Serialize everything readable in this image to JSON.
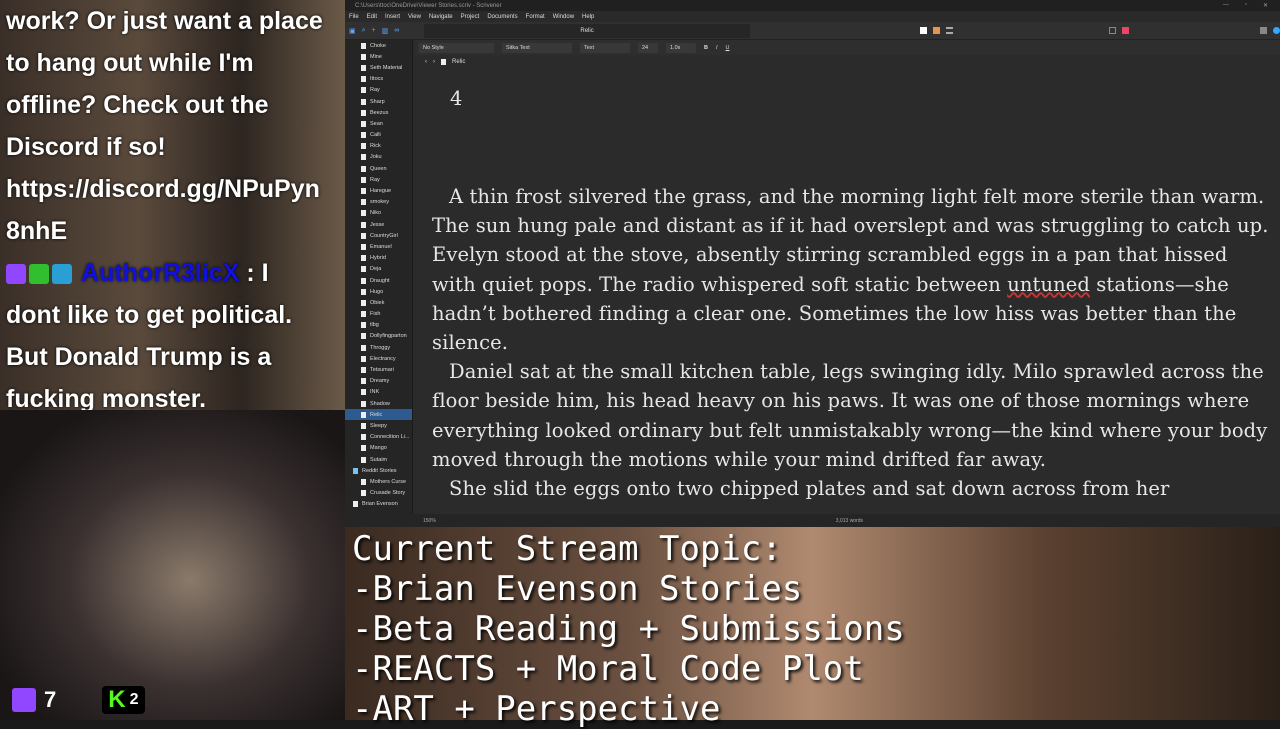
{
  "chat": {
    "lines": [
      "work? Or just want a place",
      "to hang out while I'm",
      "offline? Check out the",
      "Discord if so!",
      "https://discord.gg/NPuPyn",
      "8nhE"
    ],
    "username": "AuthorR3licX",
    "message_sep": " : I",
    "message_lines": [
      "dont like to get political.",
      "But Donald Trump is a",
      "fucking monster."
    ]
  },
  "stats": {
    "twitch_viewers": "7",
    "kick_viewers": "2",
    "kick_logo": "K"
  },
  "app": {
    "title": "C:\\Users\\ttoc\\OneDrive\\Viewer Stories.scriv - Scrivener",
    "menu": [
      "File",
      "Edit",
      "Insert",
      "View",
      "Navigate",
      "Project",
      "Documents",
      "Format",
      "Window",
      "Help"
    ],
    "doc_title": "Relic",
    "format": {
      "style": "No Style",
      "font": "Sitka Text",
      "typeface": "Text",
      "size": "24",
      "spacing": "1.0x",
      "bold": "B",
      "italic": "I",
      "underline": "U"
    },
    "header_doc": "Relic",
    "binder": [
      {
        "label": "Choke"
      },
      {
        "label": "Mine"
      },
      {
        "label": "Seth Material"
      },
      {
        "label": "Ittocs"
      },
      {
        "label": "Ray"
      },
      {
        "label": "Sharp"
      },
      {
        "label": "Beezus"
      },
      {
        "label": "Sean"
      },
      {
        "label": "Calli"
      },
      {
        "label": "Rick"
      },
      {
        "label": "Joku"
      },
      {
        "label": "Queen"
      },
      {
        "label": "Ray"
      },
      {
        "label": "Haregue"
      },
      {
        "label": "smokey"
      },
      {
        "label": "Niko"
      },
      {
        "label": "Jesse"
      },
      {
        "label": "CountryGirl"
      },
      {
        "label": "Emanuel"
      },
      {
        "label": "Hybrid"
      },
      {
        "label": "Deja"
      },
      {
        "label": "Draught"
      },
      {
        "label": "Hugo"
      },
      {
        "label": "Obiek"
      },
      {
        "label": "Fish"
      },
      {
        "label": "tlbg"
      },
      {
        "label": "Dollyfingparton"
      },
      {
        "label": "Throggy"
      },
      {
        "label": "Electrancy"
      },
      {
        "label": "Tetsumari"
      },
      {
        "label": "Dreamy"
      },
      {
        "label": "INK"
      },
      {
        "label": "Shadow"
      },
      {
        "label": "Relic",
        "selected": true
      },
      {
        "label": "Sleepy"
      },
      {
        "label": "Connecition Li..."
      },
      {
        "label": "Mango"
      },
      {
        "label": "Sutaim"
      },
      {
        "label": "Reddit Stories",
        "folder": true
      },
      {
        "label": "Mothers Curse"
      },
      {
        "label": "Crusade Story"
      },
      {
        "label": "Brian Evenson",
        "top": true
      }
    ],
    "editor": {
      "chapter": "4",
      "paragraphs": [
        [
          "A thin frost silvered the grass, and the morning light felt more sterile than warm. The sun hung pale and distant as if it had overslept and was struggling to catch up. Evelyn stood at the stove, absently stirring scrambled eggs in a pan that hissed with quiet pops. The radio whispered soft static between ",
          "untuned",
          " stations—she hadn’t bothered finding a clear one. Sometimes the low hiss was better than the silence."
        ],
        [
          "Daniel sat at the small kitchen table, legs swinging idly. Milo sprawled across the floor beside him, his head heavy on his paws. It was one of those mornings where everything looked ordinary but felt unmistakably wrong—the kind where your body moved through the motions while your mind drifted far away."
        ],
        [
          "She slid the eggs onto two chipped plates and sat down across from her"
        ]
      ]
    },
    "status": {
      "zoom": "150%",
      "words": "3,013 words"
    }
  },
  "topic": {
    "lines": [
      "Current Stream Topic:",
      "-Brian Evenson Stories",
      "-Beta Reading + Submissions",
      "-REACTS + Moral Code Plot",
      "-ART + Perspective"
    ]
  }
}
